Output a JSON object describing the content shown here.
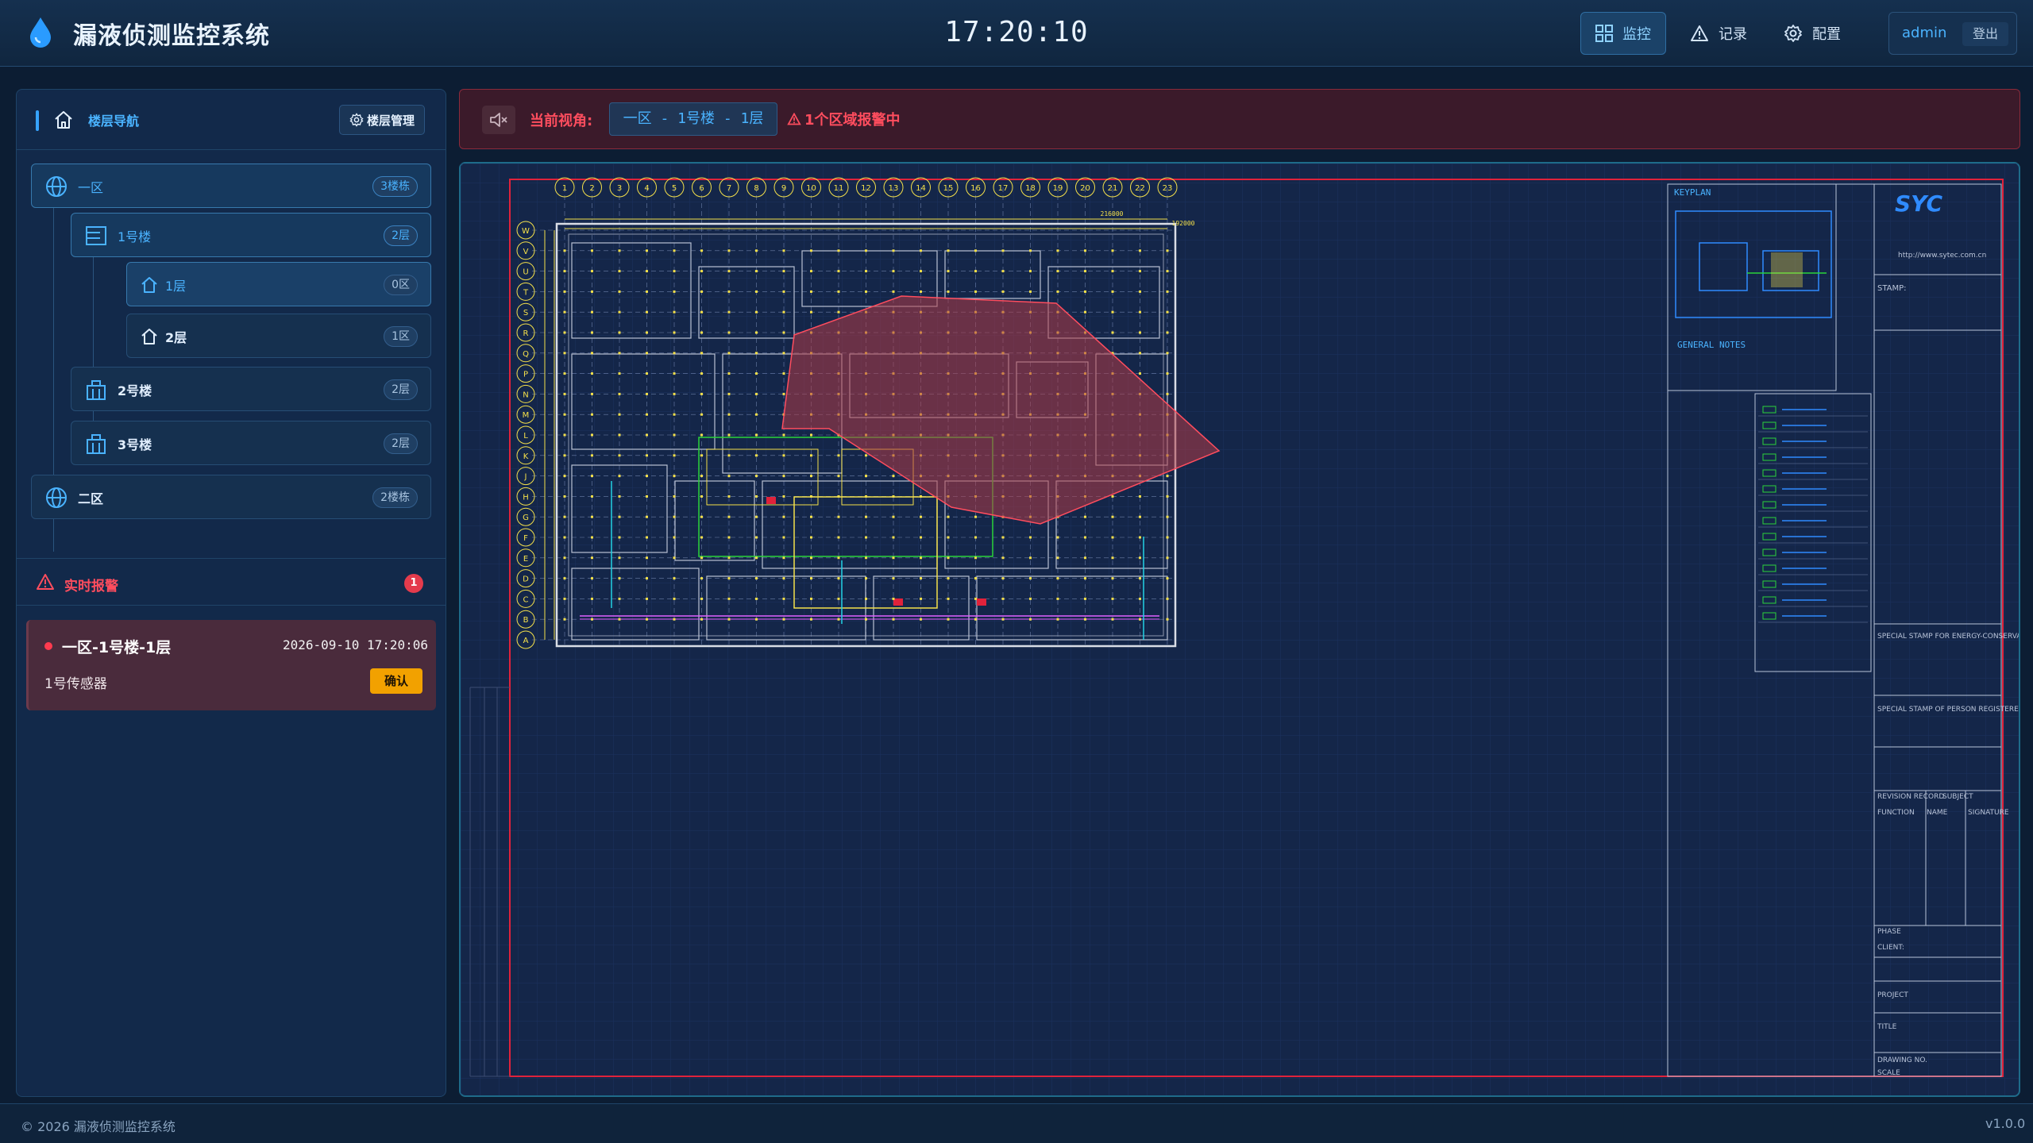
{
  "app": {
    "title": "漏液侦测监控系统",
    "clock": "17:20:10"
  },
  "nav": {
    "monitor": "监控",
    "records": "记录",
    "config": "配置"
  },
  "user": {
    "name": "admin",
    "logout": "登出"
  },
  "sidebar": {
    "title": "楼层导航",
    "floor_mgmt": "楼层管理",
    "tree": [
      {
        "label": "一区",
        "badge": "3楼栋"
      },
      {
        "label": "1号楼",
        "badge": "2层"
      },
      {
        "label": "1层",
        "badge": "0区"
      },
      {
        "label": "2层",
        "badge": "1区"
      },
      {
        "label": "2号楼",
        "badge": "2层"
      },
      {
        "label": "3号楼",
        "badge": "2层"
      },
      {
        "label": "二区",
        "badge": "2楼栋"
      }
    ]
  },
  "alarms": {
    "title": "实时报警",
    "count": "1",
    "items": [
      {
        "location": "一区-1号楼-1层",
        "time": "2026-09-10 17:20:06",
        "sensor": "1号传感器",
        "action": "确认"
      }
    ]
  },
  "view_bar": {
    "label": "当前视角:",
    "value": "一区 - 1号楼 - 1层",
    "alarm_text": "1个区域报警中"
  },
  "drawing": {
    "keyplan": "KEYPLAN",
    "general_notes": "GENERAL NOTES",
    "company": "SYC",
    "url": "http://www.sytec.com.cn",
    "stamp": "STAMP:",
    "title_block": [
      "SPECIAL STAMP FOR ENERGY-CONSERVATION:",
      "SPECIAL STAMP OF PERSON REGISTERED:",
      "REVISION RECORD",
      "SUBJECT",
      "FUNCTION",
      "NAME",
      "SIGNATURE",
      "PHASE",
      "CLIENT:",
      "PROJECT",
      "TITLE",
      "DRAWING NO.",
      "SCALE"
    ],
    "col_labels": [
      "1",
      "2",
      "3",
      "4",
      "5",
      "6",
      "7",
      "8",
      "9",
      "10",
      "11",
      "12",
      "13",
      "14",
      "15",
      "16",
      "17",
      "18",
      "19",
      "20",
      "21",
      "22",
      "23"
    ],
    "row_labels": [
      "W",
      "V",
      "U",
      "T",
      "S",
      "R",
      "Q",
      "P",
      "N",
      "M",
      "L",
      "K",
      "J",
      "H",
      "G",
      "F",
      "E",
      "D",
      "C",
      "B",
      "A"
    ],
    "dimension_total": "216000",
    "dimension_sub": "192000"
  },
  "colors": {
    "accent": "#4ab3ff",
    "alarm": "#ff4d5e",
    "confirm": "#f2a100",
    "cad_yellow": "#f4e04a"
  },
  "footer": {
    "copyright": "© 2026 漏液侦测监控系统",
    "version": "v1.0.0"
  }
}
